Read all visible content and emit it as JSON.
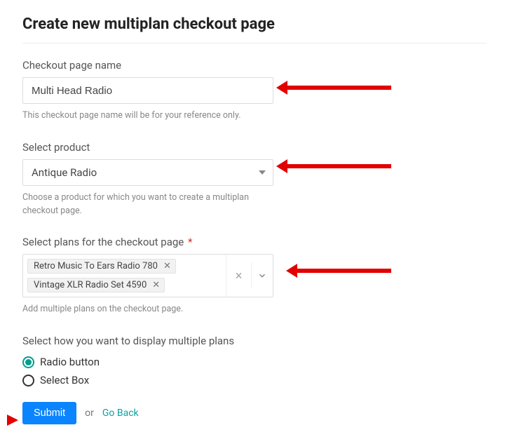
{
  "title": "Create new multiplan checkout page",
  "name_field": {
    "label": "Checkout page name",
    "value": "Multi Head Radio",
    "helper": "This checkout page name will be for your reference only."
  },
  "product_field": {
    "label": "Select product",
    "value": "Antique Radio",
    "helper": "Choose a product for which you want to create a multiplan checkout page."
  },
  "plans_field": {
    "label": "Select plans for the checkout page",
    "required_mark": "*",
    "chips": [
      "Retro Music To Ears Radio 780",
      "Vintage XLR Radio Set 4590"
    ],
    "helper": "Add multiple plans on the checkout page."
  },
  "display_field": {
    "label": "Select how you want to display multiple plans",
    "options": {
      "radio": "Radio button",
      "select": "Select Box"
    },
    "selected": "radio"
  },
  "actions": {
    "submit": "Submit",
    "or": "or",
    "go_back": "Go Back"
  }
}
